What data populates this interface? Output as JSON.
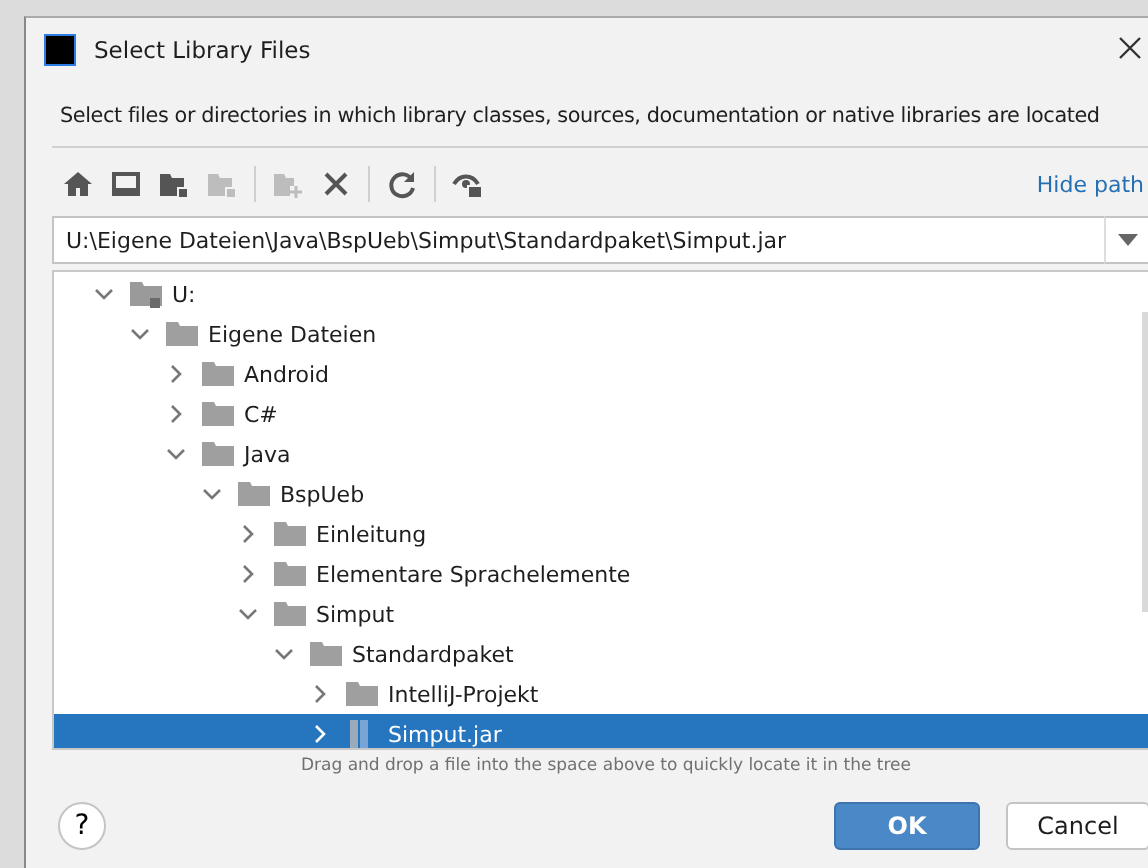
{
  "window": {
    "title": "Select Library Files"
  },
  "description": "Select files or directories in which library classes, sources, documentation or native libraries are located",
  "toolbar": [
    {
      "kind": "home",
      "disabled": false
    },
    {
      "kind": "desktop",
      "disabled": false
    },
    {
      "kind": "folder",
      "disabled": false
    },
    {
      "kind": "folder",
      "disabled": true
    },
    {
      "kind": "separator"
    },
    {
      "kind": "new-folder",
      "disabled": true
    },
    {
      "kind": "delete",
      "disabled": false
    },
    {
      "kind": "separator"
    },
    {
      "kind": "refresh",
      "disabled": false
    },
    {
      "kind": "separator"
    },
    {
      "kind": "hidden",
      "disabled": false
    }
  ],
  "hide_path_link": "Hide path",
  "path": {
    "value": "U:\\Eigene Dateien\\Java\\BspUeb\\Simput\\Standardpaket\\Simput.jar"
  },
  "tree": [
    {
      "label": "U:",
      "kind": "drive",
      "expanded": true,
      "selected": false,
      "children": [
        {
          "label": "Eigene Dateien",
          "kind": "folder",
          "expanded": true,
          "selected": false,
          "children": [
            {
              "label": "Android",
              "kind": "folder",
              "expanded": false,
              "selected": false
            },
            {
              "label": "C#",
              "kind": "folder",
              "expanded": false,
              "selected": false
            },
            {
              "label": "Java",
              "kind": "folder",
              "expanded": true,
              "selected": false,
              "children": [
                {
                  "label": "BspUeb",
                  "kind": "folder",
                  "expanded": true,
                  "selected": false,
                  "children": [
                    {
                      "label": "Einleitung",
                      "kind": "folder",
                      "expanded": false,
                      "selected": false
                    },
                    {
                      "label": "Elementare Sprachelemente",
                      "kind": "folder",
                      "expanded": false,
                      "selected": false
                    },
                    {
                      "label": "Simput",
                      "kind": "folder",
                      "expanded": true,
                      "selected": false,
                      "children": [
                        {
                          "label": "Standardpaket",
                          "kind": "folder",
                          "expanded": true,
                          "selected": false,
                          "children": [
                            {
                              "label": "IntelliJ-Projekt",
                              "kind": "folder",
                              "expanded": false,
                              "selected": false
                            },
                            {
                              "label": "Simput.jar",
                              "kind": "jar",
                              "expanded": false,
                              "selected": true
                            }
                          ]
                        }
                      ]
                    }
                  ]
                }
              ]
            }
          ]
        }
      ]
    }
  ],
  "hint": "Drag and drop a file into the space above to quickly locate it in the tree",
  "help_button": "?",
  "buttons": [
    {
      "label": "OK",
      "kind": "primary"
    },
    {
      "label": "Cancel",
      "kind": "secondary"
    }
  ]
}
